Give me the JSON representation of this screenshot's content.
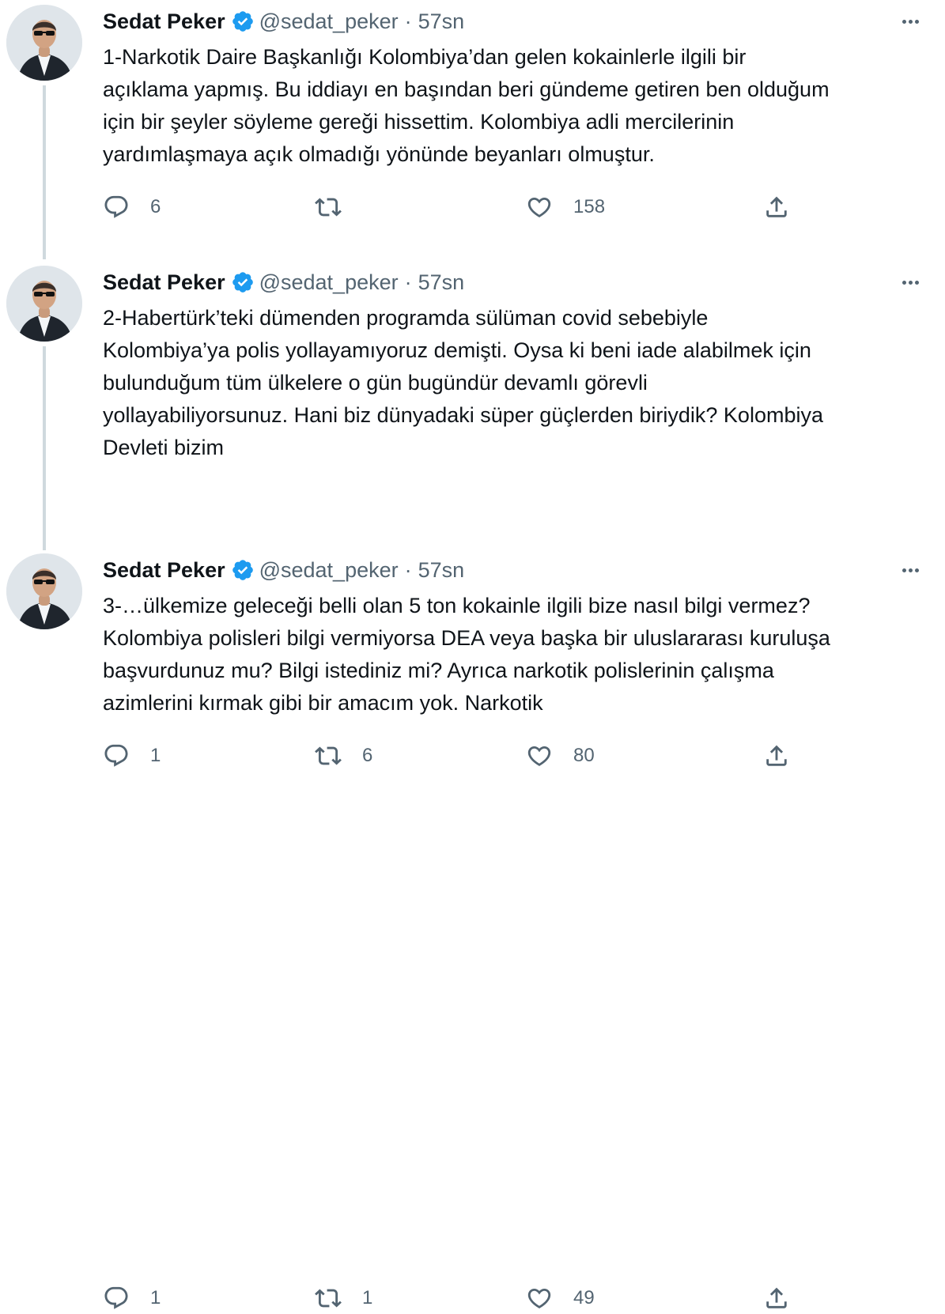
{
  "author": {
    "display_name": "Sedat Peker",
    "handle": "@sedat_peker",
    "verified_icon": "verified-badge-icon",
    "avatar_icon": "profile-photo"
  },
  "colors": {
    "text": "#0f1419",
    "secondary": "#536471",
    "verified": "#1d9bf0",
    "thread_line": "#cfd9de"
  },
  "tweets": [
    {
      "time": "57sn",
      "text": "1-Narkotik Daire Başkanlığı Kolombiya’dan gelen kokainlerle ilgili bir\naçıklama yapmış. Bu iddiayı en başından beri gündeme getiren ben olduğum\niçin bir şeyler söyleme gereği hissettim. Kolombiya adli mercilerinin\nyardımlaşmaya açık olmadığı yönünde beyanları olmuştur.",
      "replies": "6",
      "retweets": "",
      "likes": "158"
    },
    {
      "time": "57sn",
      "text": "2-Habertürk’teki dümenden programda sülüman covid sebebiyle\nKolombiya’ya polis yollayamıyoruz demişti. Oysa ki beni iade alabilmek için\nbulunduğum tüm ülkelere o gün bugündür devamlı görevli\nyollayabiliyorsunuz. Hani biz dünyadaki süper güçlerden biriydik? Kolombiya\nDevleti bizim",
      "replies": "1",
      "retweets": "6",
      "likes": "80"
    },
    {
      "time": "57sn",
      "text": "3-…ülkemize geleceği belli olan 5 ton kokainle ilgili bize nasıl bilgi vermez?\nKolombiya polisleri bilgi vermiyorsa DEA veya başka bir uluslararası kuruluşa\nbaşvurdunuz mu? Bilgi istediniz mi? Ayrıca narkotik polislerinin çalışma\nazimlerini kırmak gibi bir amacım yok. Narkotik",
      "replies": "1",
      "retweets": "1",
      "likes": "49"
    }
  ]
}
